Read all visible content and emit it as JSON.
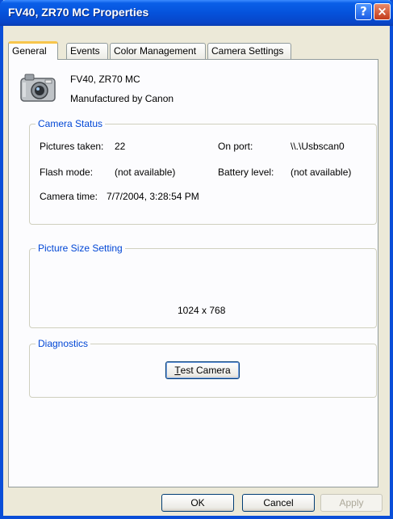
{
  "window": {
    "title": "FV40, ZR70 MC Properties",
    "help_glyph": "?",
    "close_glyph": "×"
  },
  "tabs": [
    {
      "label": "General",
      "active": true
    },
    {
      "label": "Events",
      "active": false
    },
    {
      "label": "Color Management",
      "active": false
    },
    {
      "label": "Camera Settings",
      "active": false
    }
  ],
  "device": {
    "icon": "camera-icon",
    "name": "FV40, ZR70 MC",
    "manufacturer": "Manufactured by  Canon"
  },
  "camera_status": {
    "title": "Camera Status",
    "pictures_taken_label": "Pictures taken:",
    "pictures_taken_value": "22",
    "on_port_label": "On port:",
    "on_port_value": "\\\\.\\Usbscan0",
    "flash_mode_label": "Flash mode:",
    "flash_mode_value": "(not available)",
    "battery_level_label": "Battery level:",
    "battery_level_value": "(not available)",
    "camera_time_label": "Camera time:",
    "camera_time_value": "7/7/2004, 3:28:54 PM"
  },
  "picture_size": {
    "title": "Picture Size Setting",
    "value": "1024 x 768"
  },
  "diagnostics": {
    "title": "Diagnostics",
    "test_button_underlined": "T",
    "test_button_rest": "est Camera"
  },
  "footer": {
    "ok_label": "OK",
    "cancel_label": "Cancel",
    "apply_label": "Apply"
  },
  "colors": {
    "titlebar": "#0552db",
    "group_title": "#0046d5",
    "active_tab_accent": "#f7c54c"
  }
}
